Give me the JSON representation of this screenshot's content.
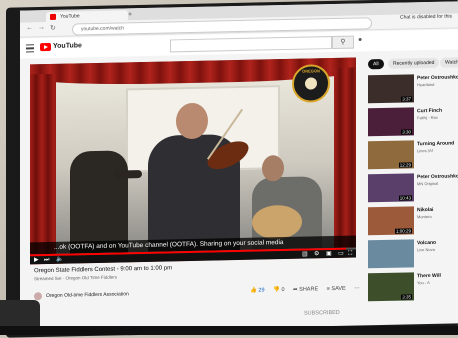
{
  "browser": {
    "tab_title": "YouTube",
    "newtab_icon": "+",
    "address": "youtube.com/watch"
  },
  "youtube": {
    "logo_text": "YouTube",
    "chat_note": "Chat is disabled for this"
  },
  "video": {
    "badge_text": "OREGON",
    "caption": "...ok (OOTFA) and on YouTube channel (OOTFA). Sharing on your social media",
    "progress": 0.97
  },
  "below": {
    "title": "Oregon State Fiddlers Contest - 9:00 am to 1:00 pm",
    "meta": "Streamed live · Oregon Old Time Fiddlers",
    "channel": "Oregon Old-time Fiddlers Association",
    "likes": "29",
    "dislikes": "0",
    "share": "SHARE",
    "save": "SAVE",
    "subscribe": "SUBSCRIBED"
  },
  "chips": {
    "all": "All",
    "recent": "Recently uploaded",
    "watched": "Watched"
  },
  "recommendations": [
    {
      "title": "Peter Ostroushko",
      "sub": "Heartland",
      "dur": "3:37",
      "color": "#3a2d2a"
    },
    {
      "title": "Curt Finch",
      "sub": "Faith) - Rav",
      "dur": "3:30",
      "color": "#4b1f3a"
    },
    {
      "title": "Turning Around",
      "sub": "Lines (Af",
      "dur": "12:29",
      "color": "#8f6a3c"
    },
    {
      "title": "Peter Ostroushko",
      "sub": "MN Original",
      "dur": "10:43",
      "color": "#5a3f6a"
    },
    {
      "title": "Nikolai",
      "sub": "Montero",
      "dur": "1:00:29",
      "color": "#9c5a3a"
    },
    {
      "title": "Volcano",
      "sub": "Live Nova",
      "dur": "",
      "color": "#6a8aa0"
    },
    {
      "title": "There Will",
      "sub": "You - A",
      "dur": "3:35",
      "color": "#3c4f2a"
    }
  ]
}
